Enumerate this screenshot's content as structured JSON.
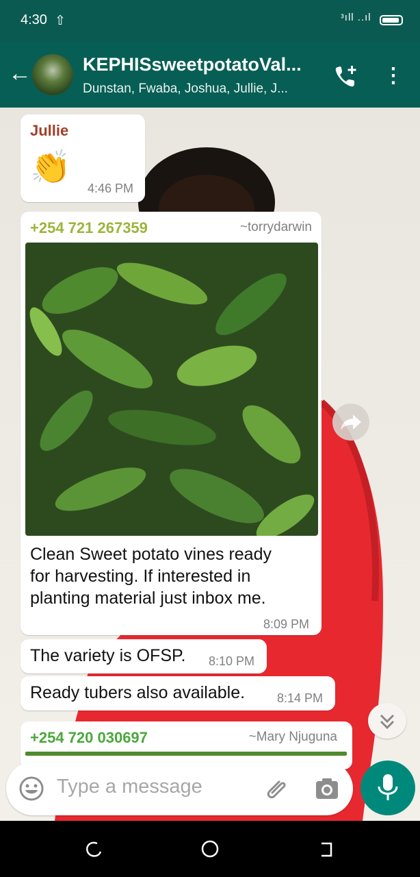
{
  "status_bar": {
    "time": "4:30",
    "signal_text": "ᵌıll ..ıl"
  },
  "header": {
    "title": "KEPHISsweetpotatoVal...",
    "subtitle": "Dunstan, Fwaba, Joshua, Jullie, J...",
    "icons": [
      "back-arrow-icon",
      "add-call-icon",
      "more-vert-icon"
    ]
  },
  "messages": [
    {
      "sender": "Jullie",
      "content": "👏",
      "time": "4:46 PM",
      "sender_color": "#a0402a"
    },
    {
      "sender": "+254 721 267359",
      "alias": "~torrydarwin",
      "caption": "Clean Sweet potato vines ready for harvesting. If interested in planting material just inbox me.",
      "time": "8:09 PM",
      "sender_color": "#9cb43a"
    },
    {
      "text": "The variety is OFSP.",
      "time": "8:10 PM"
    },
    {
      "text": "Ready tubers also available.",
      "time": "8:14 PM"
    },
    {
      "sender": "+254 720 030697",
      "alias": "~Mary Njuguna",
      "sender_color": "#4aa83a"
    }
  ],
  "caption_lines": [
    "Clean Sweet potato vines ready",
    "for harvesting. If interested in",
    "planting material just inbox me."
  ],
  "composer": {
    "placeholder": "Type a message"
  },
  "colors": {
    "header_bg": "#075e54",
    "mic_button": "#00897b",
    "bubble_bg": "#ffffff"
  }
}
